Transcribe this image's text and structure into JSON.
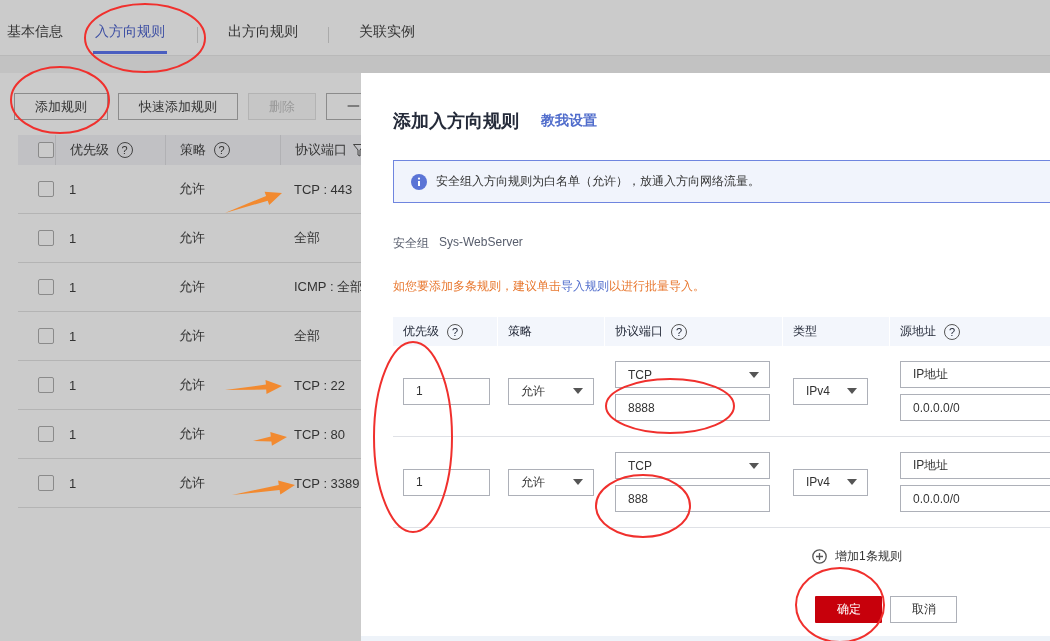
{
  "tabs": [
    {
      "label": "基本信息",
      "selected": false
    },
    {
      "label": "入方向规则",
      "selected": true
    },
    {
      "label": "出方向规则",
      "selected": false
    },
    {
      "label": "关联实例",
      "selected": false
    }
  ],
  "toolbar": [
    {
      "label": "添加规则",
      "disabled": false
    },
    {
      "label": "快速添加规则",
      "disabled": false
    },
    {
      "label": "删除",
      "disabled": true
    },
    {
      "label": "一",
      "disabled": false
    }
  ],
  "rules_table": {
    "select_all_checked": false,
    "columns": [
      {
        "label": "优先级",
        "help": "?"
      },
      {
        "label": "策略",
        "help": "?"
      },
      {
        "label": "协议端口",
        "filter": true
      }
    ],
    "rows": [
      {
        "checked": false,
        "priority": "1",
        "policy": "允许",
        "port": "TCP : 443"
      },
      {
        "checked": false,
        "priority": "1",
        "policy": "允许",
        "port": "全部"
      },
      {
        "checked": false,
        "priority": "1",
        "policy": "允许",
        "port": "ICMP : 全部"
      },
      {
        "checked": false,
        "priority": "1",
        "policy": "允许",
        "port": "全部"
      },
      {
        "checked": false,
        "priority": "1",
        "policy": "允许",
        "port": "TCP : 22"
      },
      {
        "checked": false,
        "priority": "1",
        "policy": "允许",
        "port": "TCP : 80"
      },
      {
        "checked": false,
        "priority": "1",
        "policy": "允许",
        "port": "TCP : 3389"
      }
    ]
  },
  "dialog": {
    "title": "添加入方向规则",
    "help_link": "教我设置",
    "info": "安全组入方向规则为白名单（允许），放通入方向网络流量。",
    "group_label": "安全组",
    "group_name": "Sys-WebServer",
    "note": {
      "before": "如您要添加多条规则，建议单击",
      "link": "导入规则",
      "after": "以进行批量导入。"
    },
    "columns": [
      {
        "label": "优先级",
        "help": "?"
      },
      {
        "label": "策略"
      },
      {
        "label": "协议端口",
        "help": "?"
      },
      {
        "label": "类型"
      },
      {
        "label": "源地址",
        "help": "?"
      }
    ],
    "rows": [
      {
        "priority": "1",
        "policy": "允许",
        "protocol": "TCP",
        "port": "8888",
        "ip_type": "IPv4",
        "source_type": "IP地址",
        "source": "0.0.0.0/0"
      },
      {
        "priority": "1",
        "policy": "允许",
        "protocol": "TCP",
        "port": "888",
        "ip_type": "IPv4",
        "source_type": "IP地址",
        "source": "0.0.0.0/0"
      }
    ],
    "add_rule": "增加1条规则",
    "confirm": "确定",
    "cancel": "取消"
  }
}
